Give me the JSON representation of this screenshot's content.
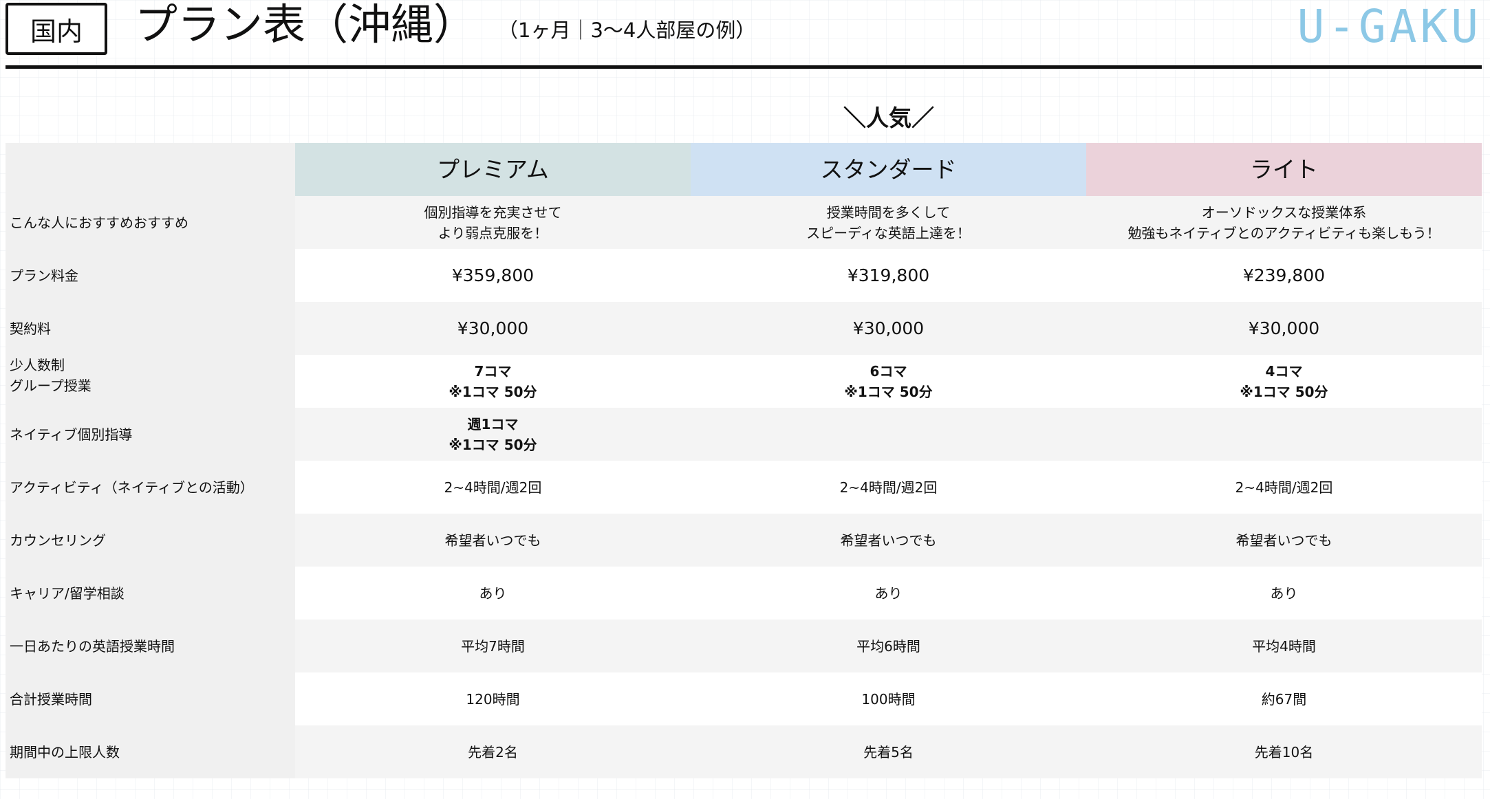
{
  "header": {
    "badge": "国内",
    "title": "プラン表（沖縄）",
    "subtitle": "（1ヶ月｜3〜4人部屋の例）",
    "logo": "U-GAKU",
    "popular": "＼人気／"
  },
  "colors": {
    "premium_header": "#d3e2e3",
    "standard_header": "#cfe1f3",
    "light_header": "#ebd2da",
    "label_background": "#f0f0f0",
    "stripe": "#f4f4f4",
    "logo": "#8cc8e6"
  },
  "plans": [
    "プレミアム",
    "スタンダード",
    "ライト"
  ],
  "rows": [
    {
      "label": [
        "こんな人におすすめおすすめ"
      ],
      "values": [
        [
          "個別指導を充実させて",
          "より弱点克服を！"
        ],
        [
          "授業時間を多くして",
          "スピーディな英語上達を！"
        ],
        [
          "オーソドックスな授業体系",
          "勉強もネイティブとのアクティビティも楽しもう！"
        ]
      ]
    },
    {
      "label": [
        "プラン料金"
      ],
      "values": [
        [
          "¥359,800"
        ],
        [
          "¥319,800"
        ],
        [
          "¥239,800"
        ]
      ]
    },
    {
      "label": [
        "契約料"
      ],
      "values": [
        [
          "¥30,000"
        ],
        [
          "¥30,000"
        ],
        [
          "¥30,000"
        ]
      ]
    },
    {
      "label": [
        "少人数制",
        "グループ授業"
      ],
      "values": [
        [
          "7コマ",
          "※1コマ 50分"
        ],
        [
          "6コマ",
          "※1コマ 50分"
        ],
        [
          "4コマ",
          "※1コマ 50分"
        ]
      ]
    },
    {
      "label": [
        "ネイティブ個別指導"
      ],
      "values": [
        [
          "週1コマ",
          "※1コマ 50分"
        ],
        [
          ""
        ],
        [
          ""
        ]
      ]
    },
    {
      "label": [
        "アクティビティ（ネイティブとの活動）"
      ],
      "values": [
        [
          "2~4時間/週2回"
        ],
        [
          "2~4時間/週2回"
        ],
        [
          "2~4時間/週2回"
        ]
      ]
    },
    {
      "label": [
        "カウンセリング"
      ],
      "values": [
        [
          "希望者いつでも"
        ],
        [
          "希望者いつでも"
        ],
        [
          "希望者いつでも"
        ]
      ]
    },
    {
      "label": [
        "キャリア/留学相談"
      ],
      "values": [
        [
          "あり"
        ],
        [
          "あり"
        ],
        [
          "あり"
        ]
      ]
    },
    {
      "label": [
        "一日あたりの英語授業時間"
      ],
      "values": [
        [
          "平均7時間"
        ],
        [
          "平均6時間"
        ],
        [
          "平均4時間"
        ]
      ]
    },
    {
      "label": [
        "合計授業時間"
      ],
      "values": [
        [
          "120時間"
        ],
        [
          "100時間"
        ],
        [
          "約67間"
        ]
      ]
    },
    {
      "label": [
        "期間中の上限人数"
      ],
      "values": [
        [
          "先着2名"
        ],
        [
          "先着5名"
        ],
        [
          "先着10名"
        ]
      ]
    }
  ]
}
